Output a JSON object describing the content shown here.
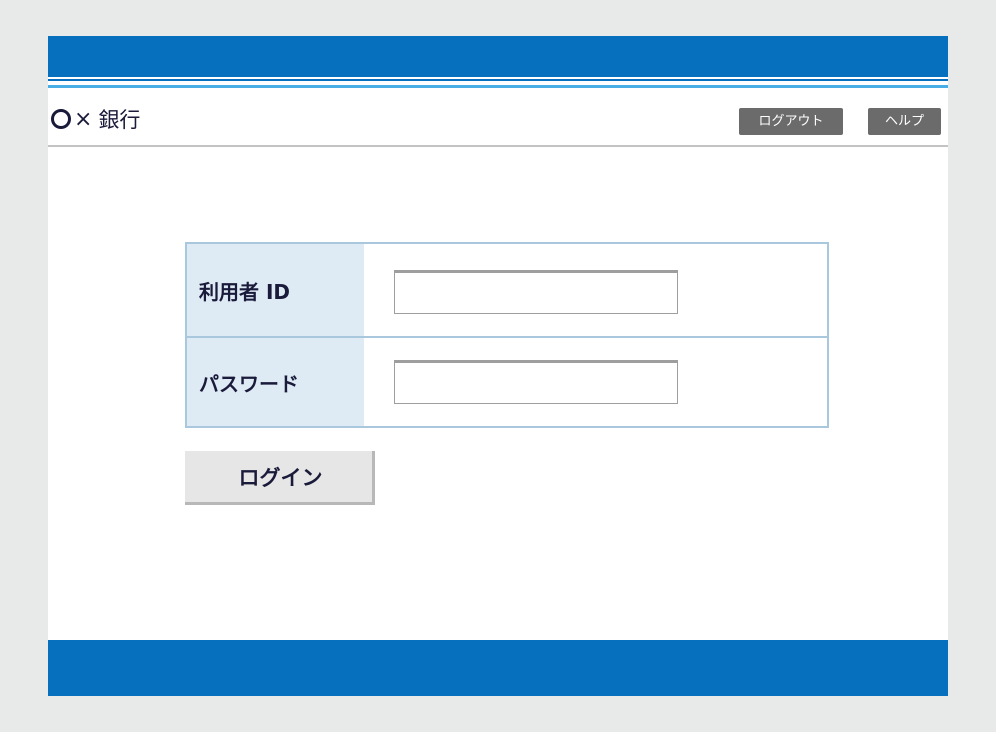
{
  "header": {
    "logo_mark": "○",
    "logo_cross": "×",
    "bank_name": "銀行",
    "logout_label": "ログアウト",
    "help_label": "ヘルプ"
  },
  "form": {
    "user_id_label": "利用者 ID",
    "user_id_value": "",
    "password_label": "パスワード",
    "password_value": "",
    "login_label": "ログイン"
  },
  "colors": {
    "brand_blue": "#0670be",
    "accent_light_blue": "#49aee5",
    "label_bg": "#deebf5",
    "border": "#a9c8de",
    "header_button": "#6b6b6b"
  }
}
